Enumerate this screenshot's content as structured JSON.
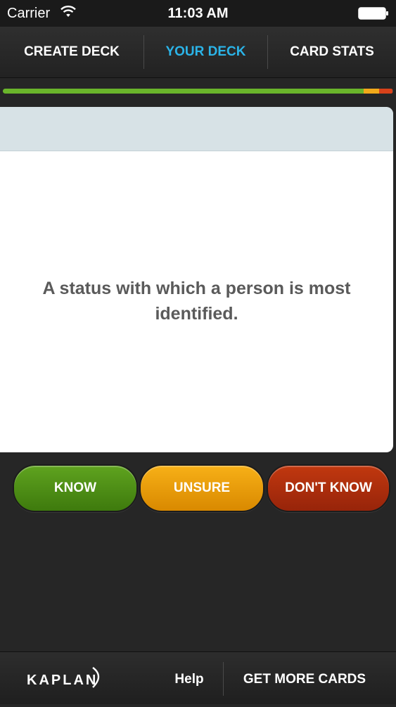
{
  "status_bar": {
    "carrier": "Carrier",
    "time": "11:03 AM",
    "wifi_icon": "wifi-icon",
    "battery_icon": "battery-icon"
  },
  "nav": {
    "tabs": [
      {
        "label": "CREATE DECK",
        "active": false
      },
      {
        "label": "YOUR DECK",
        "active": true
      },
      {
        "label": "CARD STATS",
        "active": false
      }
    ],
    "active_color": "#2bb4e8"
  },
  "progress": {
    "segments": [
      {
        "status": "know",
        "fraction": 0.925,
        "color": "#6ab52b"
      },
      {
        "status": "unsure",
        "fraction": 0.04,
        "color": "#f2a91a"
      },
      {
        "status": "dont_know",
        "fraction": 0.035,
        "color": "#d8421a"
      }
    ]
  },
  "card": {
    "prompt": "A status with which a person is most identified."
  },
  "answers": {
    "know": "KNOW",
    "unsure": "UNSURE",
    "dont_know": "DON'T KNOW"
  },
  "footer": {
    "logo": "KAPLAN",
    "help": "Help",
    "more_cards": "GET MORE CARDS"
  }
}
